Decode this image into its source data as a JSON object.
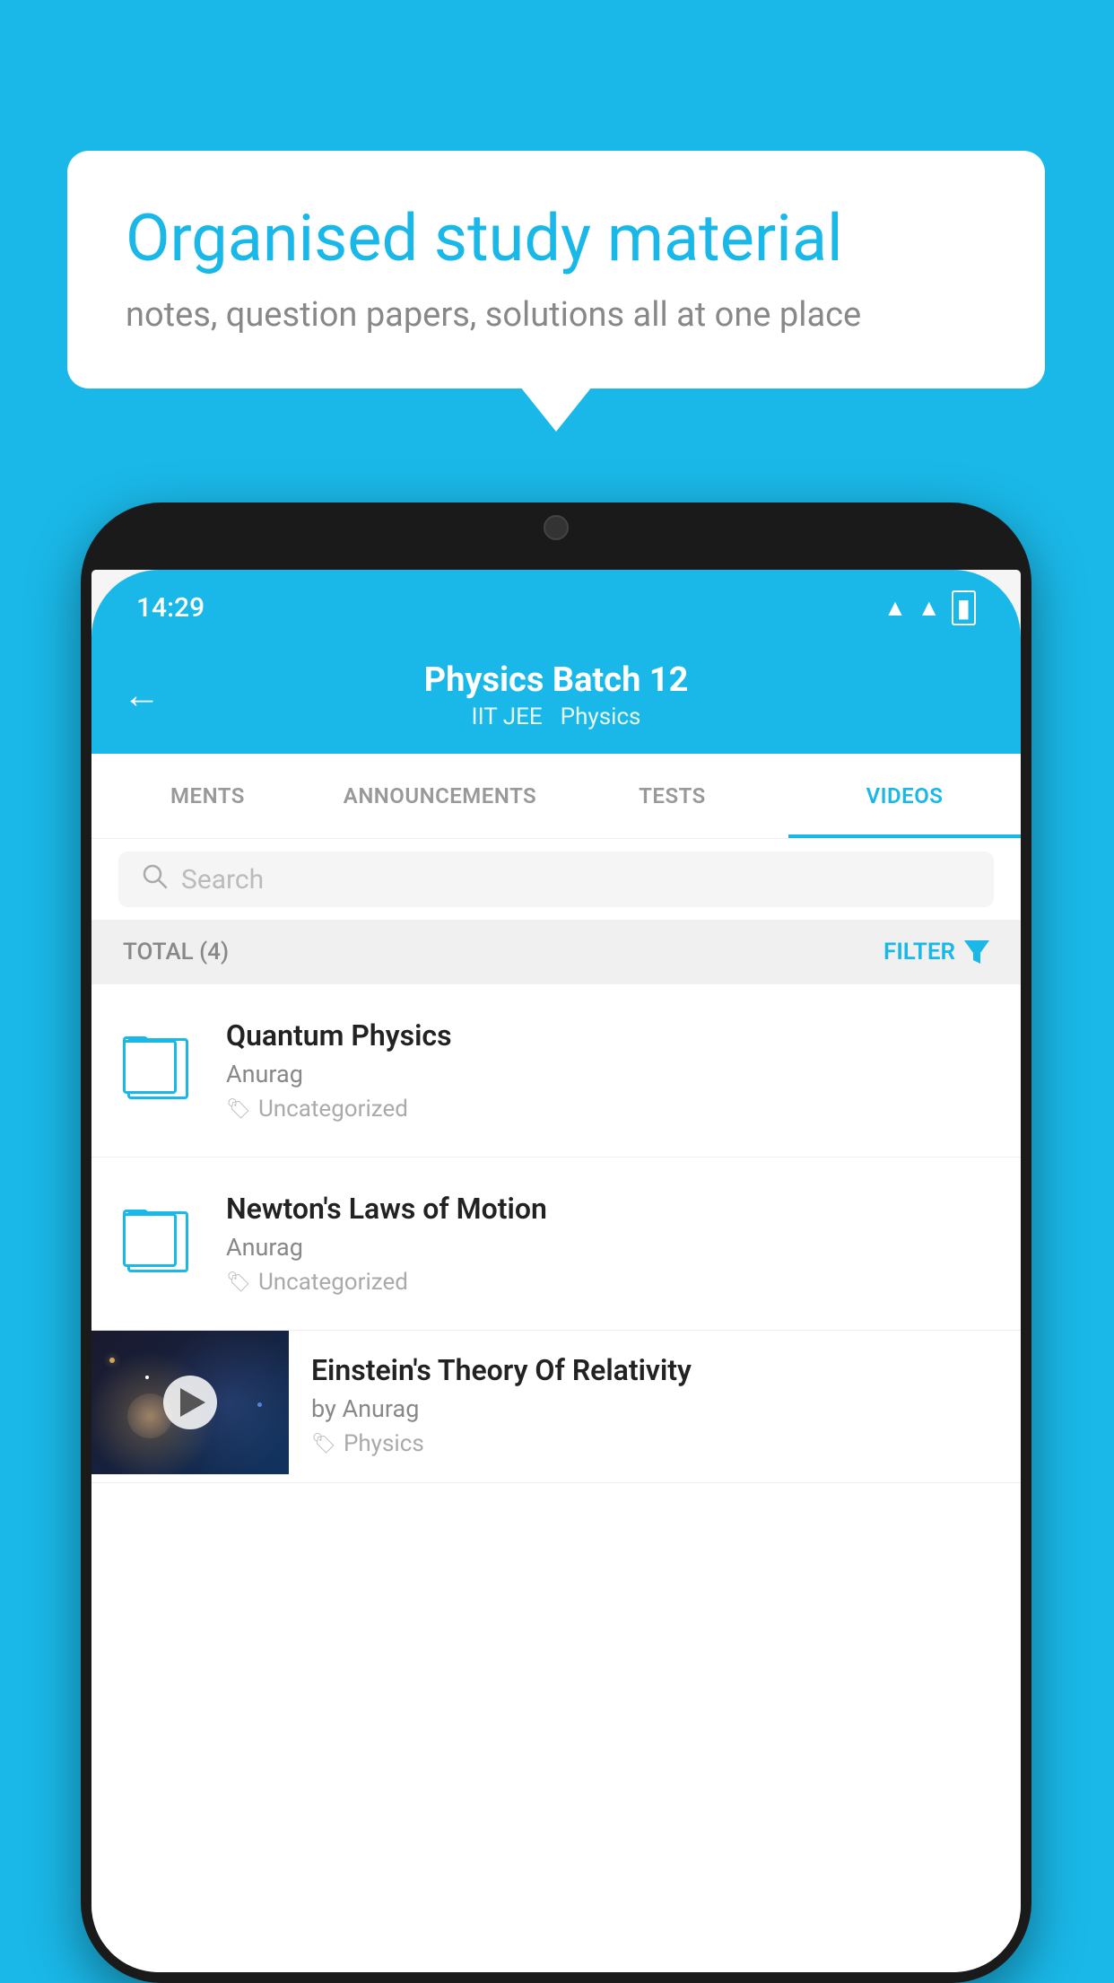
{
  "background_color": "#1ab8e8",
  "bubble": {
    "title": "Organised study material",
    "subtitle": "notes, question papers, solutions all at one place"
  },
  "status_bar": {
    "time": "14:29",
    "wifi": "▲",
    "signal": "▲",
    "battery": "▐"
  },
  "header": {
    "title": "Physics Batch 12",
    "subtitle_left": "IIT JEE",
    "subtitle_right": "Physics",
    "back_label": "←"
  },
  "tabs": [
    {
      "label": "MENTS",
      "active": false
    },
    {
      "label": "ANNOUNCEMENTS",
      "active": false
    },
    {
      "label": "TESTS",
      "active": false
    },
    {
      "label": "VIDEOS",
      "active": true
    }
  ],
  "search": {
    "placeholder": "Search"
  },
  "filter_bar": {
    "total_label": "TOTAL (4)",
    "filter_label": "FILTER"
  },
  "items": [
    {
      "title": "Quantum Physics",
      "author": "Anurag",
      "tag": "Uncategorized",
      "type": "file"
    },
    {
      "title": "Newton's Laws of Motion",
      "author": "Anurag",
      "tag": "Uncategorized",
      "type": "file"
    },
    {
      "title": "Einstein's Theory Of Relativity",
      "author": "by Anurag",
      "tag": "Physics",
      "type": "video"
    }
  ]
}
